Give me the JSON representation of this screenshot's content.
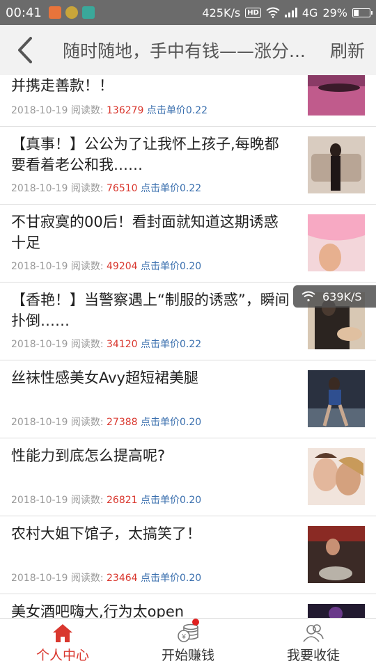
{
  "status_bar": {
    "time": "00:41",
    "net_speed": "425K/s",
    "hd_badge": "HD",
    "network_type": "4G",
    "battery": "29%",
    "battery_level": 0.29
  },
  "header": {
    "title": "随时随地，手中有钱——涨分...",
    "refresh_label": "刷新"
  },
  "articles": [
    {
      "title": "并携走善款！！",
      "date": "2018-10-19",
      "reads_label": "阅读数:",
      "reads": "136279",
      "price": "点击单价0.22"
    },
    {
      "title": "【真事！】公公为了让我怀上孩子,每晚都要看着老公和我……",
      "date": "2018-10-19",
      "reads_label": "阅读数:",
      "reads": "76510",
      "price": "点击单价0.22"
    },
    {
      "title": "不甘寂寞的00后！看封面就知道这期诱惑十足",
      "date": "2018-10-19",
      "reads_label": "阅读数:",
      "reads": "49204",
      "price": "点击单价0.20"
    },
    {
      "title": "【香艳！】当警察遇上“制服的诱惑”，瞬间扑倒……",
      "date": "2018-10-19",
      "reads_label": "阅读数:",
      "reads": "34120",
      "price": "点击单价0.22"
    },
    {
      "title": "丝袜性感美女Avy超短裙美腿",
      "date": "2018-10-19",
      "reads_label": "阅读数:",
      "reads": "27388",
      "price": "点击单价0.20"
    },
    {
      "title": "性能力到底怎么提高呢?",
      "date": "2018-10-19",
      "reads_label": "阅读数:",
      "reads": "26821",
      "price": "点击单价0.20"
    },
    {
      "title": "农村大姐下馆子，太搞笑了！",
      "date": "2018-10-19",
      "reads_label": "阅读数:",
      "reads": "23464",
      "price": "点击单价0.20"
    },
    {
      "title": "美女酒吧嗨大,行为太open",
      "date": "",
      "reads_label": "",
      "reads": "",
      "price": ""
    }
  ],
  "speed_widget": {
    "value": "639K/S"
  },
  "bottom_nav": [
    {
      "label": "个人中心",
      "active": true
    },
    {
      "label": "开始赚钱",
      "active": false,
      "badge": true
    },
    {
      "label": "我要收徒",
      "active": false
    }
  ],
  "colors": {
    "accent_red": "#d9372e",
    "price_blue": "#3a6fae",
    "status_bar": "#6b6b6b",
    "header_bg": "#f2f2f2"
  }
}
